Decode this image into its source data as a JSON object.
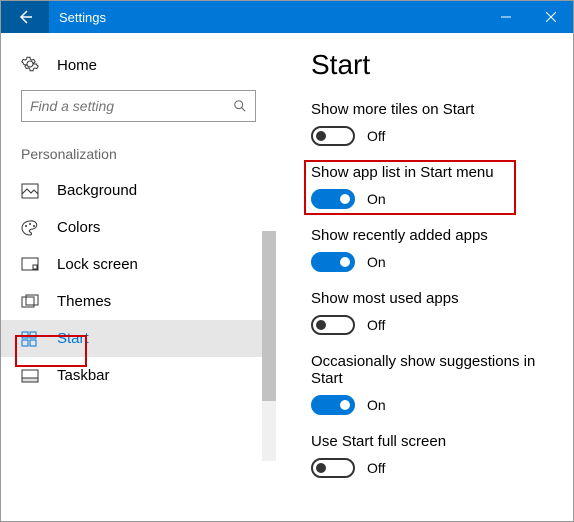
{
  "titlebar": {
    "title": "Settings"
  },
  "sidebar": {
    "home_label": "Home",
    "search_placeholder": "Find a setting",
    "section": "Personalization",
    "items": [
      {
        "label": "Background"
      },
      {
        "label": "Colors"
      },
      {
        "label": "Lock screen"
      },
      {
        "label": "Themes"
      },
      {
        "label": "Start"
      },
      {
        "label": "Taskbar"
      }
    ],
    "selected_index": 4
  },
  "main": {
    "heading": "Start",
    "settings": [
      {
        "label": "Show more tiles on Start",
        "state": "Off",
        "on": false
      },
      {
        "label": "Show app list in Start menu",
        "state": "On",
        "on": true
      },
      {
        "label": "Show recently added apps",
        "state": "On",
        "on": true
      },
      {
        "label": "Show most used apps",
        "state": "Off",
        "on": false
      },
      {
        "label": "Occasionally show suggestions in Start",
        "state": "On",
        "on": true
      },
      {
        "label": "Use Start full screen",
        "state": "Off",
        "on": false
      }
    ],
    "highlighted_index": 1
  }
}
